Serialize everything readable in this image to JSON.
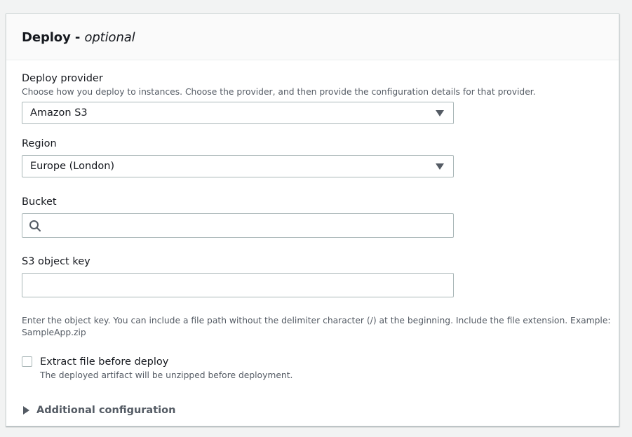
{
  "panel": {
    "title": "Deploy",
    "title_dash": "-",
    "title_optional": "optional"
  },
  "deploy_provider": {
    "label": "Deploy provider",
    "description": "Choose how you deploy to instances. Choose the provider, and then provide the configuration details for that provider.",
    "value": "Amazon S3"
  },
  "region": {
    "label": "Region",
    "value": "Europe (London)"
  },
  "bucket": {
    "label": "Bucket",
    "value": ""
  },
  "object_key": {
    "label": "S3 object key",
    "value": "",
    "help_line1": "Enter the object key. You can include a file path without the delimiter character (/) at the beginning. Include the file extension. Example:",
    "help_line2": "SampleApp.zip"
  },
  "extract": {
    "label": "Extract file before deploy",
    "description": "The deployed artifact will be unzipped before deployment.",
    "checked": false
  },
  "additional": {
    "label": "Additional configuration"
  },
  "colors": {
    "text": "#16191f",
    "secondary_text": "#545b64",
    "border": "#aab7b8",
    "header_bg": "#fafafa"
  }
}
